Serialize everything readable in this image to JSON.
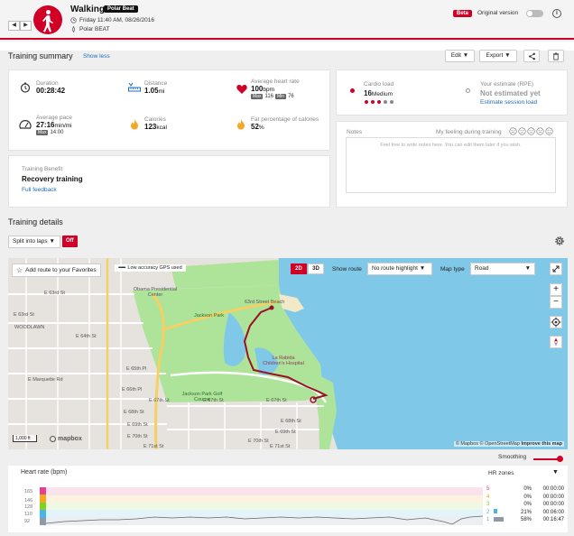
{
  "header": {
    "title": "Walking",
    "badge": "Polar Beat",
    "datetime": "Friday 11:40 AM, 08/26/2016",
    "device": "Polar BEAT",
    "beta": "Beta",
    "original_version": "Original version",
    "prev": "◀",
    "next": "▶"
  },
  "summary": {
    "title": "Training summary",
    "show_less": "Show less",
    "edit": "Edit ▼",
    "export": "Export ▼",
    "metrics": {
      "duration": {
        "label": "Duration",
        "value": "00:28:42"
      },
      "distance": {
        "label": "Distance",
        "value": "1.05",
        "unit": "mi"
      },
      "avg_hr": {
        "label": "Average heart rate",
        "value": "100",
        "unit": "bpm",
        "max_tag": "Max",
        "max": "116",
        "min_tag": "Min",
        "min": "76"
      },
      "avg_pace": {
        "label": "Average pace",
        "value": "27:16",
        "unit": "min/mi",
        "max_tag": "Max",
        "max": "14:00"
      },
      "calories": {
        "label": "Calories",
        "value": "123",
        "unit": "kcal"
      },
      "fat": {
        "label": "Fat percentage of calories",
        "value": "52",
        "unit": "%"
      }
    },
    "benefit": {
      "label": "Training Benefit",
      "value": "Recovery training",
      "link": "Full feedback"
    },
    "cardio": {
      "label": "Cardio load",
      "value": "16",
      "level": "Medium"
    },
    "rpe": {
      "label": "Your estimate (RPE)",
      "value": "Not estimated yet",
      "link": "Estimate session load"
    },
    "notes": {
      "label": "Notes",
      "feeling": "My feeling during training",
      "placeholder": "Feel free to write notes here. You can edit them later if you wish."
    }
  },
  "details": {
    "title": "Training details",
    "split": "Split into laps ▼",
    "off": "Off"
  },
  "map": {
    "add_route": "Add route to your Favorites",
    "gps": "Low accuracy GPS used",
    "btn_2d": "2D",
    "btn_3d": "3D",
    "show_route": "Show route",
    "route_select": "No route highlight ▼",
    "map_type": "Map type",
    "map_type_select": "Road",
    "scale": "1,000 ft",
    "logo": "mapbox",
    "attribution": "© Mapbox © OpenStreetMap",
    "improve": "Improve this map",
    "zoom_in": "+",
    "zoom_out": "−",
    "labels": [
      "E 63rd St",
      "E 63rd St",
      "WOODLAWN",
      "E 64th St",
      "E 65th Pl",
      "E Marquette Rd",
      "E 66th Pl",
      "E 67th St",
      "E 67th St",
      "E 67th St",
      "E 68th St",
      "E 69th St",
      "E 70th St",
      "E 71st St",
      "E 71st St",
      "E 68th St",
      "E 69th St",
      "E 70th St",
      "Jackson Park",
      "Jackson Park Golf Course",
      "Obama Presidential Center",
      "63rd Street Beach",
      "La Rabida Children's Hospital"
    ]
  },
  "smoothing": "Smoothing",
  "hr_chart": {
    "title": "Heart rate (bpm)",
    "hr_zones": "HR zones",
    "y_ticks": [
      "165",
      "146",
      "128",
      "110",
      "92"
    ],
    "zones": [
      {
        "num": "5",
        "pct": "0%",
        "time": "00:00:00",
        "color": "#e8408a"
      },
      {
        "num": "4",
        "pct": "0%",
        "time": "00:00:00",
        "color": "#f5a623"
      },
      {
        "num": "3",
        "pct": "0%",
        "time": "00:00:00",
        "color": "#7ed321"
      },
      {
        "num": "2",
        "pct": "21%",
        "time": "00:06:00",
        "color": "#4ab6e8"
      },
      {
        "num": "1",
        "pct": "58%",
        "time": "00:16:47",
        "color": "#8e9aa7"
      }
    ]
  },
  "colors": {
    "brand": "#d10027",
    "link": "#1b6fb8"
  }
}
